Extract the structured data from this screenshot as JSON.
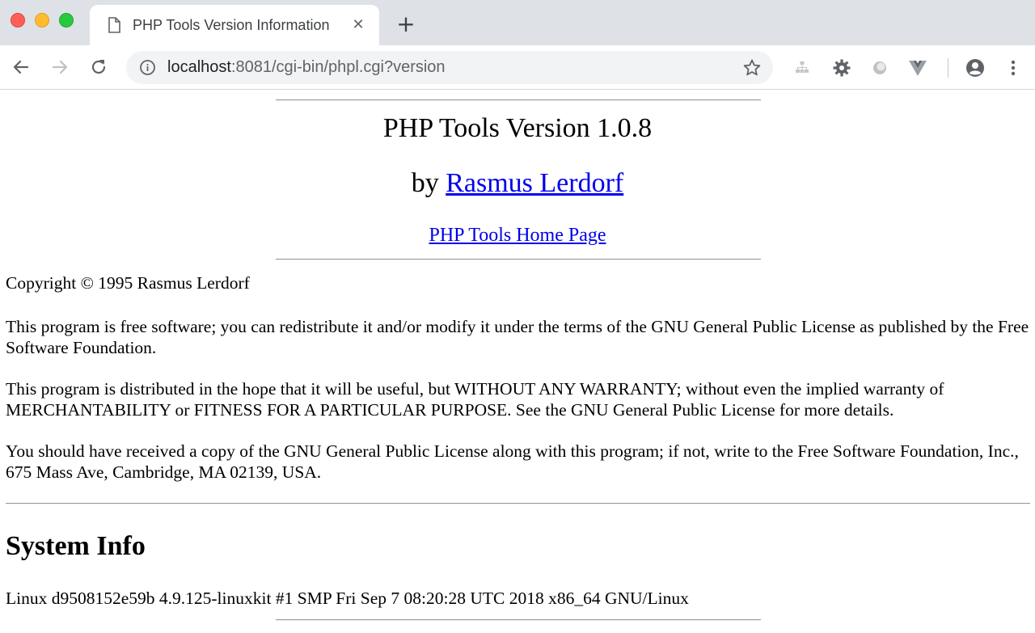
{
  "browser": {
    "tab_title": "PHP Tools Version Information",
    "tab_close_glyph": "✕",
    "new_tab_glyph": "+",
    "url_host": "localhost",
    "url_rest": ":8081/cgi-bin/phpl.cgi?version",
    "icons": [
      "back-arrow-icon",
      "forward-arrow-icon",
      "reload-icon",
      "info-icon",
      "star-icon",
      "sitemap-icon",
      "gear-icon",
      "circle-icon",
      "vuejs-icon",
      "account-icon",
      "more-vert-icon"
    ]
  },
  "page": {
    "title": "PHP Tools Version 1.0.8",
    "by_prefix": "by ",
    "author": "Rasmus Lerdorf",
    "home_link": "PHP Tools Home Page",
    "copyright": "Copyright © 1995 Rasmus Lerdorf",
    "paragraphs": [
      "This program is free software; you can redistribute it and/or modify it under the terms of the GNU General Public License as published by the Free Software Foundation.",
      "This program is distributed in the hope that it will be useful, but WITHOUT ANY WARRANTY; without even the implied warranty of MERCHANTABILITY or FITNESS FOR A PARTICULAR PURPOSE. See the GNU General Public License for more details.",
      "You should have received a copy of the GNU General Public License along with this program; if not, write to the Free Software Foundation, Inc., 675 Mass Ave, Cambridge, MA 02139, USA."
    ],
    "system_heading": "System Info",
    "system_info": "Linux d9508152e59b 4.9.125-linuxkit #1 SMP Fri Sep 7 08:20:28 UTC 2018 x86_64 GNU/Linux"
  },
  "colors": {
    "link": "#0000ee",
    "tabstrip": "#dee1e6",
    "omnibox": "#f1f3f4"
  }
}
